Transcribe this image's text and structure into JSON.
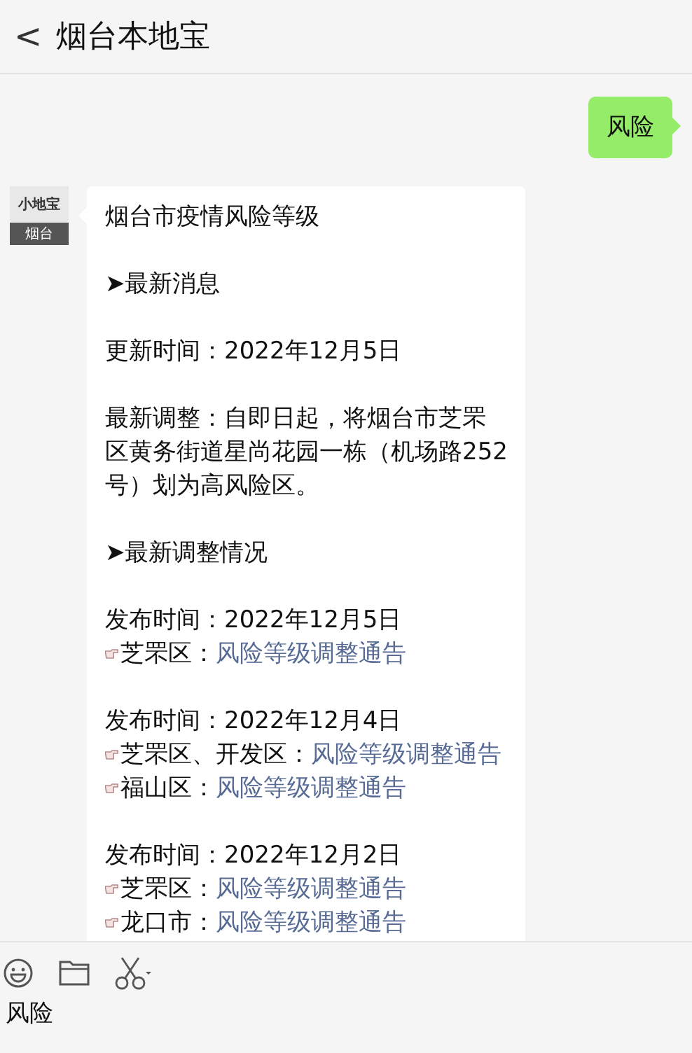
{
  "header": {
    "back": "<",
    "title": "烟台本地宝"
  },
  "messages": [
    {
      "kind": "sent",
      "text": "风险"
    },
    {
      "kind": "received",
      "avatar": {
        "top": "小地宝",
        "bottom": "烟台"
      },
      "blocks": [
        [
          {
            "kind": "text",
            "text": "烟台市疫情风险等级"
          }
        ],
        [
          {
            "kind": "text",
            "text": "➤最新消息"
          }
        ],
        [
          {
            "kind": "text",
            "text": "更新时间：2022年12月5日"
          }
        ],
        [
          {
            "kind": "text",
            "text": "最新调整：自即日起，将烟台市芝罘区黄务街道星尚花园一栋（机场路252号）划为高风险区。"
          }
        ],
        [
          {
            "kind": "text",
            "text": "➤最新调整情况"
          }
        ],
        [
          {
            "kind": "text",
            "text": "发布时间：2022年12月5日"
          },
          {
            "kind": "notice",
            "label": "芝罘区：",
            "link": "风险等级调整通告"
          }
        ],
        [
          {
            "kind": "text",
            "text": "发布时间：2022年12月4日"
          },
          {
            "kind": "notice",
            "label": "芝罘区、开发区：",
            "link": "风险等级调整通告"
          },
          {
            "kind": "notice",
            "label": "福山区：",
            "link": "风险等级调整通告"
          }
        ],
        [
          {
            "kind": "text",
            "text": "发布时间：2022年12月2日"
          },
          {
            "kind": "notice",
            "label": "芝罘区：",
            "link": "风险等级调整通告"
          },
          {
            "kind": "notice",
            "label": "龙口市：",
            "link": "风险等级调整通告"
          }
        ]
      ]
    }
  ],
  "input": {
    "value": "风险"
  }
}
